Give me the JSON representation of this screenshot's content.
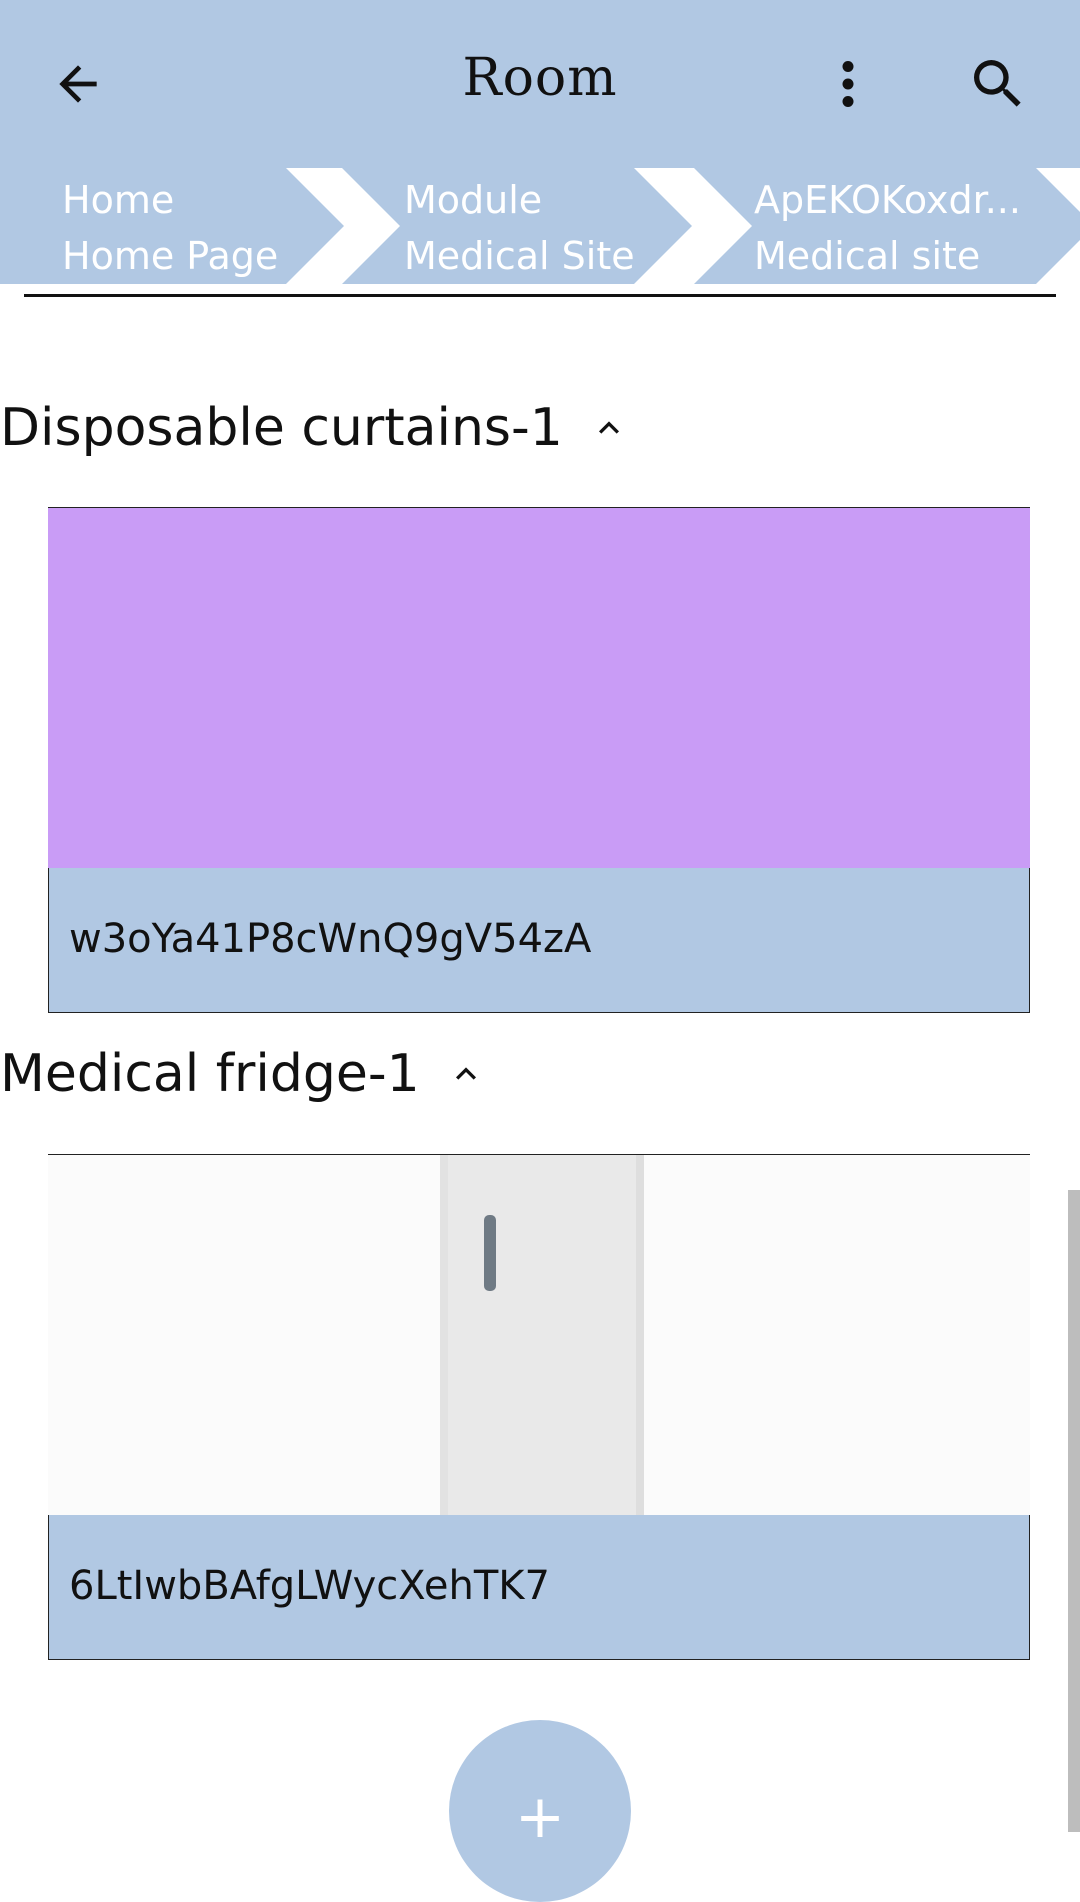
{
  "appbar": {
    "title": "Room",
    "back_icon": "arrow-back-icon",
    "more_icon": "more-vert-icon",
    "search_icon": "search-icon"
  },
  "breadcrumbs": [
    {
      "line1": "Home",
      "line2": "Home Page"
    },
    {
      "line1": "Module",
      "line2": "Medical Site"
    },
    {
      "line1": "ApEKOKoxdr...",
      "line2": "Medical site"
    }
  ],
  "sections": [
    {
      "title": "Disposable curtains-1",
      "item_label": "w3oYa41P8cWnQ9gV54zA",
      "image_color": "#c99cf6"
    },
    {
      "title": "Medical fridge-1",
      "item_label": "6LtIwbBAfgLWycXehTK7"
    }
  ],
  "fab": {
    "label": "+"
  },
  "colors": {
    "primary": "#b1c8e3",
    "accent_purple": "#c99cf6"
  }
}
